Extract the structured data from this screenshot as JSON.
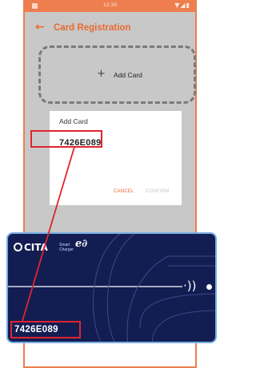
{
  "status_bar": {
    "time": "12:30",
    "icons": "▼◢▮"
  },
  "app_bar": {
    "back_icon": "←",
    "title": "Card Registration"
  },
  "add_card_slot": {
    "plus": "+",
    "label": "Add Card"
  },
  "dialog": {
    "title": "Add Card",
    "input_value": "7426E089",
    "cancel_label": "CANCEL",
    "confirm_label": "CONFIRM"
  },
  "card": {
    "logo_text": "CITA",
    "tagline_1": "Smart",
    "tagline_2": "Charger",
    "brand_mark": "e∂",
    "nfc_symbol": "·))",
    "serial": "7426E089"
  },
  "colors": {
    "accent": "#ea6a2f",
    "card_bg": "#131d52",
    "highlight": "#e0242e",
    "overlay": "#c8c8c8"
  }
}
